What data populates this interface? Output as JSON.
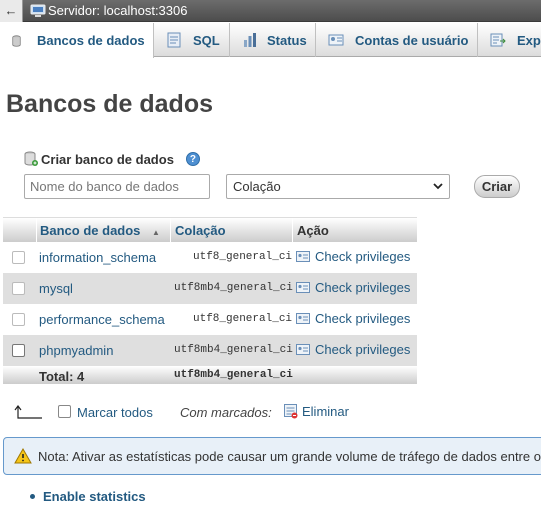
{
  "topbar": {
    "back": "←",
    "server_label": "Servidor: localhost:3306"
  },
  "tabs": [
    {
      "label": "Bancos de dados",
      "icon": "database-icon",
      "active": true
    },
    {
      "label": "SQL",
      "icon": "sql-icon"
    },
    {
      "label": "Status",
      "icon": "status-icon"
    },
    {
      "label": "Contas de usuário",
      "icon": "user-accounts-icon"
    },
    {
      "label": "Exp",
      "icon": "export-icon"
    }
  ],
  "page_title": "Bancos de dados",
  "create": {
    "heading": "Criar banco de dados",
    "help": "?",
    "name_placeholder": "Nome do banco de dados",
    "collation_value": "Colação",
    "button": "Criar"
  },
  "table": {
    "headers": {
      "name": "Banco de dados",
      "sort_indicator": "▲",
      "collation": "Colação",
      "action": "Ação"
    },
    "rows": [
      {
        "name": "information_schema",
        "collation": "utf8_general_ci",
        "action": "Check privileges"
      },
      {
        "name": "mysql",
        "collation": "utf8mb4_general_ci",
        "action": "Check privileges"
      },
      {
        "name": "performance_schema",
        "collation": "utf8_general_ci",
        "action": "Check privileges"
      },
      {
        "name": "phpmyadmin",
        "collation": "utf8mb4_general_ci",
        "action": "Check privileges"
      }
    ],
    "total_label": "Total: 4",
    "total_collation": "utf8mb4_general_ci"
  },
  "bulk": {
    "check_all": "Marcar todos",
    "with_selected": "Com marcados:",
    "drop": "Eliminar"
  },
  "notice": "Nota: Ativar as estatísticas pode causar um grande volume de tráfego de dados entre o",
  "enable_stats": "Enable statistics",
  "colors": {
    "link": "#235a81",
    "row_alt": "#dfdfdf",
    "row": "#ffffff"
  }
}
